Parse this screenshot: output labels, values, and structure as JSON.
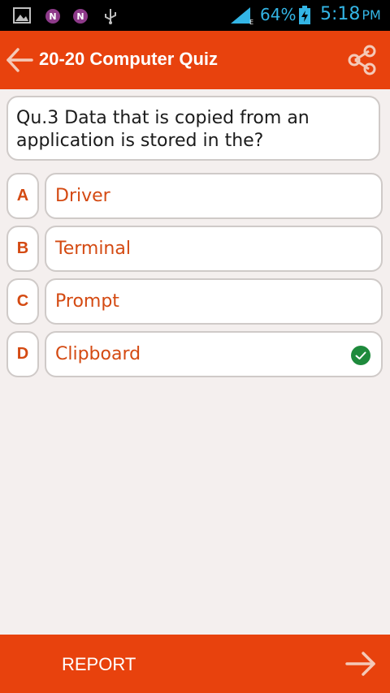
{
  "status_bar": {
    "icons": [
      "gallery-icon",
      "onenote-icon",
      "onenote-icon",
      "usb-icon",
      "signal-icon",
      "battery-charging-icon"
    ],
    "battery_percent": "64%",
    "time": "5:18",
    "ampm": "PM"
  },
  "app_bar": {
    "title": "20-20 Computer Quiz",
    "back_icon": "arrow-left-icon",
    "share_icon": "share-icon"
  },
  "question": {
    "text": "Qu.3 Data that is copied from an application is stored in the?"
  },
  "options": [
    {
      "letter": "A",
      "text": "Driver",
      "selected": false
    },
    {
      "letter": "B",
      "text": "Terminal",
      "selected": false
    },
    {
      "letter": "C",
      "text": "Prompt",
      "selected": false
    },
    {
      "letter": "D",
      "text": "Clipboard",
      "selected": true
    }
  ],
  "bottom_bar": {
    "report_label": "REPORT",
    "next_icon": "arrow-right-icon"
  },
  "colors": {
    "accent": "#e8420d",
    "option_text": "#d44a12",
    "correct": "#1e8a3c",
    "status_text": "#33b5e5",
    "background": "#f4efee"
  }
}
